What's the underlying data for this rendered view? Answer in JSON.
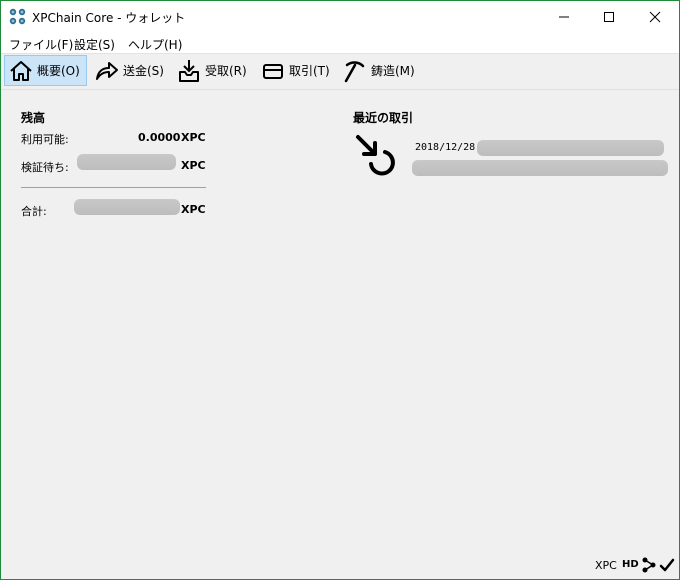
{
  "window": {
    "title": "XPChain Core - ウォレット"
  },
  "menu": {
    "items": [
      "ファイル(F)",
      "設定(S)",
      "ヘルプ(H)"
    ]
  },
  "toolbar": {
    "overview": "概要(O)",
    "send": "送金(S)",
    "receive": "受取(R)",
    "transactions": "取引(T)",
    "mining": "鋳造(M)"
  },
  "balances": {
    "title": "残高",
    "available_label": "利用可能:",
    "available_value": "0.0000",
    "pending_label": "検証待ち:",
    "total_label": "合計:",
    "unit": "XPC"
  },
  "recent": {
    "title": "最近の取引",
    "tx_date": "2018/12/28"
  },
  "status": {
    "unit": "XPC",
    "hd": "HD"
  },
  "colors": {
    "active_tab_bg": "#cce4f7",
    "active_tab_border": "#99c9ef",
    "window_border": "#1e8a3a"
  }
}
